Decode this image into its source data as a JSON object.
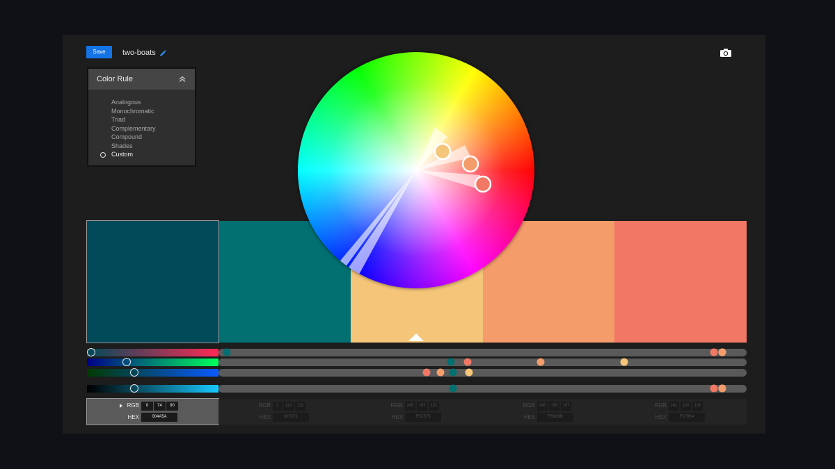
{
  "header": {
    "save_label": "Save",
    "theme_name": "two-boats"
  },
  "color_rule": {
    "title": "Color Rule",
    "options": [
      "Analogous",
      "Monochromatic",
      "Triad",
      "Complementary",
      "Compound",
      "Shades",
      "Custom"
    ],
    "selected": "Custom"
  },
  "icons": {
    "edit": "pencil-icon",
    "camera": "camera-icon",
    "collapse": "chevron-up-icon"
  },
  "swatches": [
    {
      "hex": "004A5A",
      "color": "#004A5A",
      "rgb": [
        "0",
        "74",
        "90"
      ]
    },
    {
      "hex": "027071",
      "color": "#027071",
      "rgb": [
        "2",
        "112",
        "113"
      ]
    },
    {
      "hex": "F5C579",
      "color": "#F5C579",
      "rgb": [
        "245",
        "197",
        "121"
      ]
    },
    {
      "hex": "F59C6B",
      "color": "#F59C6B",
      "rgb": [
        "245",
        "156",
        "107"
      ]
    },
    {
      "hex": "F17864",
      "color": "#F17864",
      "rgb": [
        "241",
        "120",
        "100"
      ]
    }
  ],
  "labels": {
    "rgb": "RGB",
    "hex": "HEX"
  },
  "selected_swatch": 0,
  "base_swatch": 2,
  "slider_rows": [
    {
      "channel": "red",
      "values": [
        0,
        2,
        245,
        245,
        241
      ]
    },
    {
      "channel": "green",
      "values": [
        74,
        112,
        197,
        156,
        120
      ]
    },
    {
      "channel": "blue",
      "values": [
        90,
        113,
        121,
        107,
        100
      ]
    },
    {
      "channel": "brightness",
      "values": [
        90,
        113,
        245,
        245,
        241
      ]
    }
  ]
}
